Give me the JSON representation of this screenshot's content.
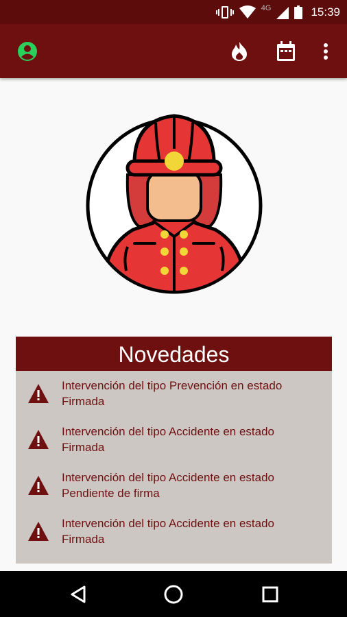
{
  "status_bar": {
    "network": "4G",
    "time": "15:39"
  },
  "app_bar": {
    "icons": [
      "account-icon",
      "fire-icon",
      "calendar-icon",
      "more-vert-icon"
    ]
  },
  "news": {
    "title": "Novedades",
    "items": [
      {
        "line1": "Intervención del tipo Prevención en estado",
        "line2": "Firmada"
      },
      {
        "line1": "Intervención del tipo Accidente en estado",
        "line2": "Firmada"
      },
      {
        "line1": "Intervención del tipo Accidente en estado",
        "line2": "Pendiente de firma"
      },
      {
        "line1": "Intervención del tipo Accidente en estado",
        "line2": "Firmada"
      }
    ]
  },
  "colors": {
    "primary": "#6e1010",
    "status_bar": "#5d0c0c",
    "news_bg": "#ccc7c3",
    "account_green": "#2bd05c"
  }
}
